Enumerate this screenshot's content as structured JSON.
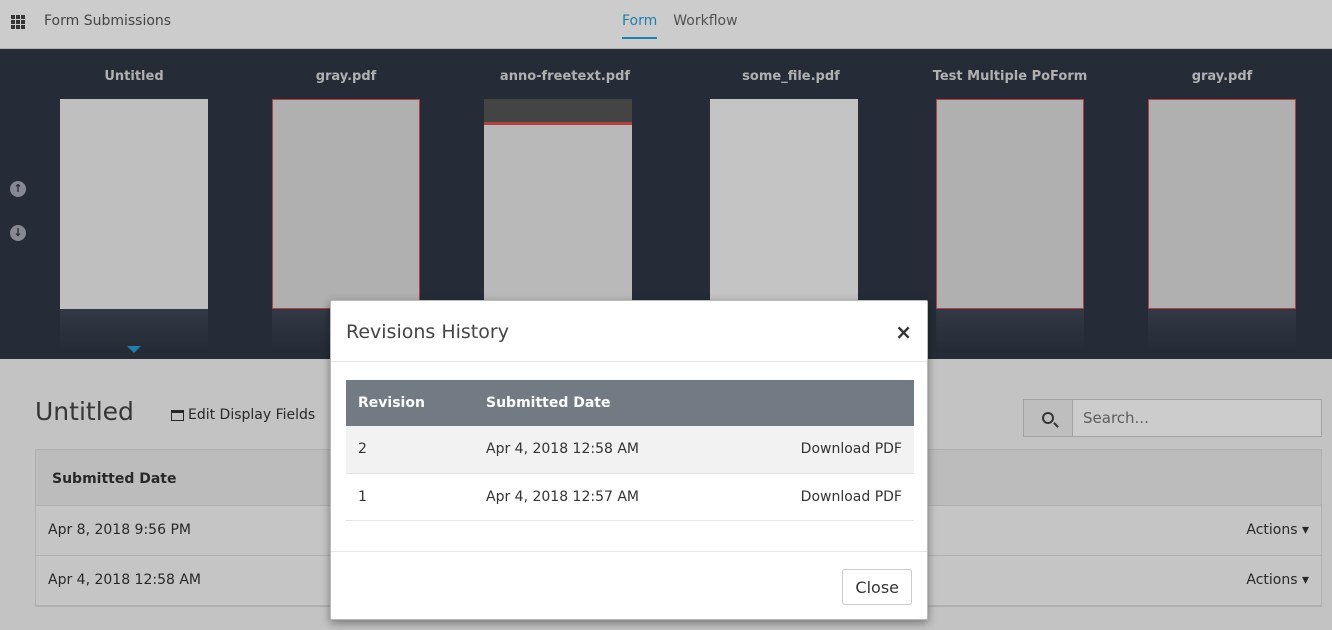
{
  "app": {
    "title": "Form Submissions"
  },
  "tabs": [
    {
      "label": "Form",
      "active": true
    },
    {
      "label": "Workflow",
      "active": false
    }
  ],
  "strip": {
    "thumbnails": [
      {
        "title": "Untitled"
      },
      {
        "title": "gray.pdf"
      },
      {
        "title": "anno-freetext.pdf"
      },
      {
        "title": "some_file.pdf"
      },
      {
        "title": "Test Multiple PoForm"
      },
      {
        "title": "gray.pdf"
      }
    ]
  },
  "page": {
    "title": "Untitled",
    "edit_fields_label": "Edit Display Fields",
    "search_placeholder": "Search...",
    "table": {
      "header": "Submitted Date",
      "rows": [
        {
          "date": "Apr 8, 2018 9:56 PM",
          "actions": "Actions ▾"
        },
        {
          "date": "Apr 4, 2018 12:58 AM",
          "actions": "Actions ▾"
        }
      ]
    }
  },
  "modal": {
    "title": "Revisions History",
    "close_x": "×",
    "columns": [
      "Revision",
      "Submitted Date"
    ],
    "rows": [
      {
        "revision": "2",
        "date": "Apr 4, 2018 12:58 AM",
        "action": "Download PDF"
      },
      {
        "revision": "1",
        "date": "Apr 4, 2018 12:57 AM",
        "action": "Download PDF"
      }
    ],
    "close_button": "Close"
  },
  "colors": {
    "accent": "#2a9fd6",
    "strip_bg": "#2f3845",
    "table_header": "#727b84"
  }
}
